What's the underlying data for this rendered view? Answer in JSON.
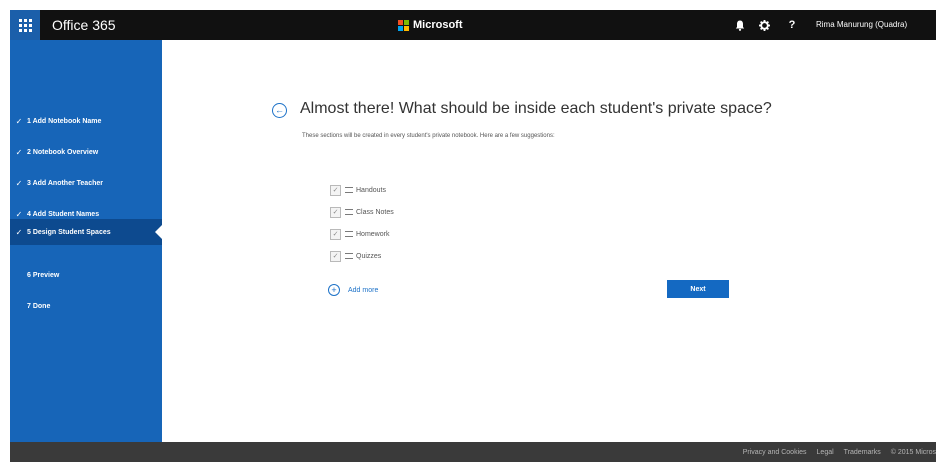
{
  "topbar": {
    "app_title": "Office 365",
    "brand": "Microsoft",
    "user_name": "Rima Manurung (Quadra)",
    "icons": [
      "waffle-icon",
      "bell-icon",
      "gear-icon",
      "help-icon"
    ],
    "help_label": "?"
  },
  "sidebar": {
    "steps": [
      {
        "label": "1  Add Notebook Name",
        "done": true,
        "check": "✓"
      },
      {
        "label": "2  Notebook Overview",
        "done": true,
        "check": "✓"
      },
      {
        "label": "3  Add Another Teacher",
        "done": true,
        "check": "✓"
      },
      {
        "label": "4  Add Student Names",
        "done": true,
        "check": "✓"
      },
      {
        "label": "5  Design Student Spaces",
        "done": true,
        "check": "✓",
        "active": true
      },
      {
        "label": "6  Preview",
        "done": false,
        "check": ""
      },
      {
        "label": "7  Done",
        "done": false,
        "check": ""
      }
    ]
  },
  "main": {
    "heading": "Almost there! What should be inside each student's private space?",
    "subtext": "These sections will be created in every student's private notebook. Here are a few suggestions:",
    "sections": [
      {
        "label": "Handouts",
        "checked": true
      },
      {
        "label": "Class Notes",
        "checked": true
      },
      {
        "label": "Homework",
        "checked": true
      },
      {
        "label": "Quizzes",
        "checked": true
      }
    ],
    "add_more": "Add more",
    "next": "Next"
  },
  "footer": {
    "links": [
      "Privacy and Cookies",
      "Legal",
      "Trademarks",
      "© 2015 Micros"
    ]
  },
  "colors": {
    "topbar": "#111111",
    "waffle": "#1b5faa",
    "sidebar": "#1765b8",
    "sidebar_active": "#0d4a8f",
    "accent": "#1d72c8",
    "button": "#1469c2",
    "footer": "#3a3a3a",
    "ms_logo": [
      "#f25022",
      "#7fba00",
      "#00a4ef",
      "#ffb900"
    ]
  }
}
